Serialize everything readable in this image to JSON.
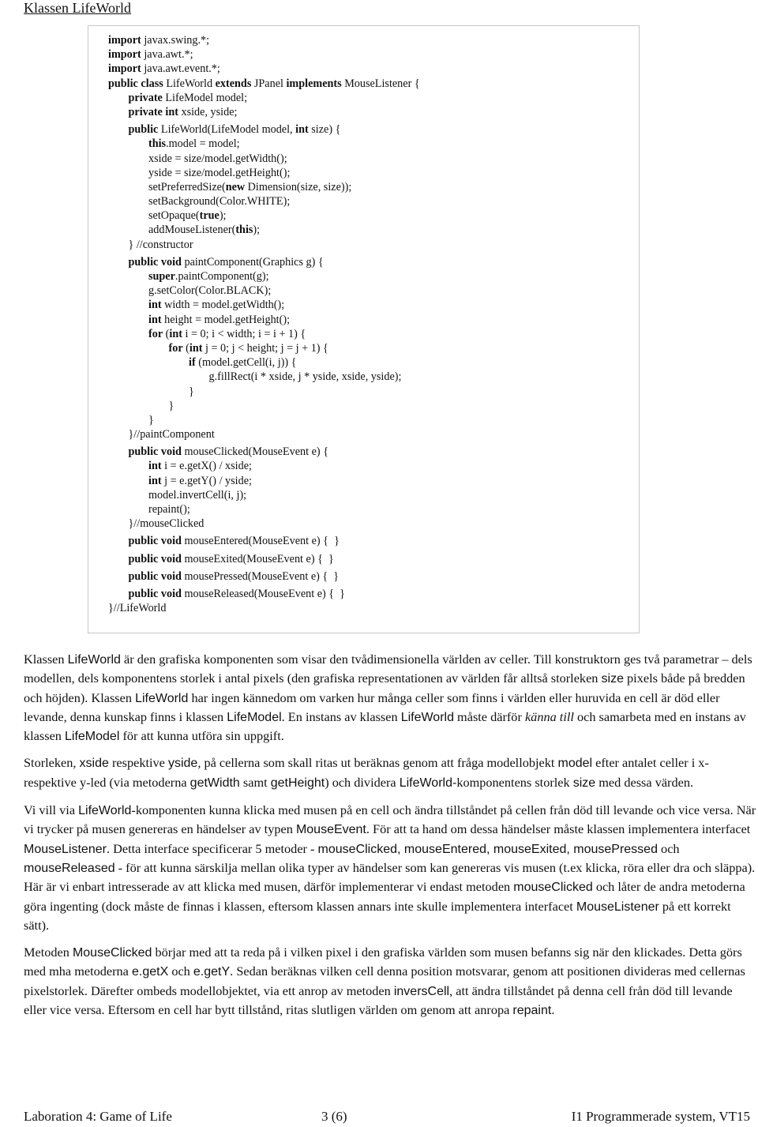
{
  "title": "Klassen LifeWorld",
  "code": [
    {
      "lines": [
        {
          "i": 0,
          "s": [
            [
              "import",
              1
            ],
            [
              " javax.swing.*;",
              0
            ]
          ]
        },
        {
          "i": 0,
          "s": [
            [
              "import",
              1
            ],
            [
              " java.awt.*;",
              0
            ]
          ]
        },
        {
          "i": 0,
          "s": [
            [
              "import",
              1
            ],
            [
              " java.awt.event.*;",
              0
            ]
          ]
        },
        {
          "i": 0,
          "s": [
            [
              "public class",
              1
            ],
            [
              " LifeWorld ",
              0
            ],
            [
              "extends",
              1
            ],
            [
              " JPanel ",
              0
            ],
            [
              "implements",
              1
            ],
            [
              " MouseListener {",
              0
            ]
          ]
        },
        {
          "i": 1,
          "s": [
            [
              "private",
              1
            ],
            [
              " LifeModel model;",
              0
            ]
          ]
        },
        {
          "i": 1,
          "s": [
            [
              "private int",
              1
            ],
            [
              " xside, yside;",
              0
            ]
          ]
        }
      ]
    },
    {
      "lines": [
        {
          "i": 1,
          "s": [
            [
              "public",
              1
            ],
            [
              " LifeWorld(LifeModel model, ",
              0
            ],
            [
              "int",
              1
            ],
            [
              " size) {",
              0
            ]
          ]
        },
        {
          "i": 2,
          "s": [
            [
              "this",
              1
            ],
            [
              ".model = model;",
              0
            ]
          ]
        },
        {
          "i": 2,
          "s": [
            [
              "xside = size/model.getWidth();",
              0
            ]
          ]
        },
        {
          "i": 2,
          "s": [
            [
              "yside = size/model.getHeight();",
              0
            ]
          ]
        },
        {
          "i": 2,
          "s": [
            [
              "setPreferredSize(",
              0
            ],
            [
              "new",
              1
            ],
            [
              " Dimension(size, size));",
              0
            ]
          ]
        },
        {
          "i": 2,
          "s": [
            [
              "setBackground(Color.WHITE);",
              0
            ]
          ]
        },
        {
          "i": 2,
          "s": [
            [
              "setOpaque(",
              0
            ],
            [
              "true",
              1
            ],
            [
              ");",
              0
            ]
          ]
        },
        {
          "i": 2,
          "s": [
            [
              "addMouseListener(",
              0
            ],
            [
              "this",
              1
            ],
            [
              ");",
              0
            ]
          ]
        },
        {
          "i": 1,
          "s": [
            [
              "} //constructor",
              0
            ]
          ]
        }
      ]
    },
    {
      "lines": [
        {
          "i": 1,
          "s": [
            [
              "public void",
              1
            ],
            [
              " paintComponent(Graphics g) {",
              0
            ]
          ]
        },
        {
          "i": 2,
          "s": [
            [
              "super",
              1
            ],
            [
              ".paintComponent(g);",
              0
            ]
          ]
        },
        {
          "i": 2,
          "s": [
            [
              "g.setColor(Color.BLACK);",
              0
            ]
          ]
        },
        {
          "i": 2,
          "s": [
            [
              "int",
              1
            ],
            [
              " width = model.getWidth();",
              0
            ]
          ]
        },
        {
          "i": 2,
          "s": [
            [
              "int",
              1
            ],
            [
              " height = model.getHeight();",
              0
            ]
          ]
        },
        {
          "i": 2,
          "s": [
            [
              "for",
              1
            ],
            [
              " (",
              0
            ],
            [
              "int",
              1
            ],
            [
              " i = 0; i < width; i = i + 1) {",
              0
            ]
          ]
        },
        {
          "i": 3,
          "s": [
            [
              "for",
              1
            ],
            [
              " (",
              0
            ],
            [
              "int",
              1
            ],
            [
              " j = 0; j < height; j = j + 1) {",
              0
            ]
          ]
        },
        {
          "i": 4,
          "s": [
            [
              "if",
              1
            ],
            [
              " (model.getCell(i, j)) {",
              0
            ]
          ]
        },
        {
          "i": 5,
          "s": [
            [
              "g.fillRect(i * xside, j * yside, xside, yside);",
              0
            ]
          ]
        },
        {
          "i": 4,
          "s": [
            [
              "}",
              0
            ]
          ]
        },
        {
          "i": 3,
          "s": [
            [
              "}",
              0
            ]
          ]
        },
        {
          "i": 2,
          "s": [
            [
              "}",
              0
            ]
          ]
        },
        {
          "i": 1,
          "s": [
            [
              "}//paintComponent",
              0
            ]
          ]
        }
      ]
    },
    {
      "lines": [
        {
          "i": 1,
          "s": [
            [
              "public void",
              1
            ],
            [
              " mouseClicked(MouseEvent e) {",
              0
            ]
          ]
        },
        {
          "i": 2,
          "s": [
            [
              "int",
              1
            ],
            [
              " i = e.getX() / xside;",
              0
            ]
          ]
        },
        {
          "i": 2,
          "s": [
            [
              "int",
              1
            ],
            [
              " j = e.getY() / yside;",
              0
            ]
          ]
        },
        {
          "i": 2,
          "s": [
            [
              "model.invertCell(i, j);",
              0
            ]
          ]
        },
        {
          "i": 2,
          "s": [
            [
              "repaint();",
              0
            ]
          ]
        },
        {
          "i": 1,
          "s": [
            [
              "}//mouseClicked",
              0
            ]
          ]
        }
      ]
    },
    {
      "lines": [
        {
          "i": 1,
          "s": [
            [
              "public void",
              1
            ],
            [
              " mouseEntered(MouseEvent e) {  }",
              0
            ]
          ]
        }
      ]
    },
    {
      "lines": [
        {
          "i": 1,
          "s": [
            [
              "public void",
              1
            ],
            [
              " mouseExited(MouseEvent e) {  }",
              0
            ]
          ]
        }
      ]
    },
    {
      "lines": [
        {
          "i": 1,
          "s": [
            [
              "public void",
              1
            ],
            [
              " mousePressed(MouseEvent e) {  }",
              0
            ]
          ]
        }
      ]
    },
    {
      "lines": [
        {
          "i": 1,
          "s": [
            [
              "public void",
              1
            ],
            [
              " mouseReleased(MouseEvent e) {  }",
              0
            ]
          ]
        },
        {
          "i": 0,
          "s": [
            [
              "}//LifeWorld",
              0
            ]
          ]
        }
      ]
    }
  ],
  "paragraphs": [
    [
      [
        "Klassen ",
        ""
      ],
      [
        "LifeWorld",
        "c"
      ],
      [
        " är den grafiska komponenten som visar den tvådimensionella världen av celler. Till konstruktorn ges två parametrar – dels modellen, dels komponentens storlek i antal pixels (den grafiska representationen av världen får alltså storleken ",
        ""
      ],
      [
        "size",
        "c"
      ],
      [
        " pixels både på bredden och höjden). Klassen ",
        ""
      ],
      [
        "LifeWorld",
        "c"
      ],
      [
        " har ingen kännedom om varken hur många celler som finns i världen eller huruvida en cell är död eller levande, denna kunskap finns i klassen ",
        ""
      ],
      [
        "LifeModel",
        "c"
      ],
      [
        ". En instans av klassen ",
        ""
      ],
      [
        "LifeWorld",
        "c"
      ],
      [
        "  måste därför ",
        ""
      ],
      [
        "känna till",
        "e"
      ],
      [
        " och samarbeta med en instans av klassen ",
        ""
      ],
      [
        "LifeModel",
        "c"
      ],
      [
        " för att kunna utföra sin uppgift.",
        ""
      ]
    ],
    [
      [
        "Storleken, ",
        ""
      ],
      [
        "xside",
        "c"
      ],
      [
        " respektive ",
        ""
      ],
      [
        "yside",
        "c"
      ],
      [
        ", på cellerna som skall ritas ut beräknas genom att fråga modellobjekt ",
        ""
      ],
      [
        "model",
        "c"
      ],
      [
        " efter antalet celler i x- respektive y-led (via metoderna ",
        ""
      ],
      [
        "getWidth",
        "c"
      ],
      [
        " samt ",
        ""
      ],
      [
        "getHeight",
        "c"
      ],
      [
        ") och dividera ",
        ""
      ],
      [
        "LifeWorld-",
        "c"
      ],
      [
        "komponentens storlek ",
        ""
      ],
      [
        "size",
        "c"
      ],
      [
        " med dessa värden.",
        ""
      ]
    ],
    [
      [
        "Vi vill via ",
        ""
      ],
      [
        "LifeWorld",
        "c"
      ],
      [
        "-komponenten kunna klicka med musen på en cell och ändra tillståndet på cellen från död till levande och vice versa. När vi trycker på musen genereras en händelser av typen ",
        ""
      ],
      [
        "MouseEvent",
        "c"
      ],
      [
        ". För att ta hand om dessa händelser måste klassen implementera interfacet ",
        ""
      ],
      [
        "MouseListener",
        "c"
      ],
      [
        ". Detta interface specificerar 5 metoder - ",
        ""
      ],
      [
        "mouseClicked, mouseEntered, mouseExited, mousePressed",
        "c"
      ],
      [
        " och ",
        ""
      ],
      [
        "mouseReleased",
        "c"
      ],
      [
        " - för att kunna särskilja mellan olika typer av händelser som kan genereras vis musen (t.ex klicka, röra eller dra och släppa). Här är vi enbart intresserade av att klicka med musen, därför implementerar vi endast metoden ",
        ""
      ],
      [
        "mouseClicked",
        "c"
      ],
      [
        " och låter de andra metoderna göra ingenting (dock måste de finnas i klassen, eftersom klassen annars inte skulle implementera interfacet ",
        ""
      ],
      [
        "MouseListener",
        "c"
      ],
      [
        " på ett korrekt sätt).",
        ""
      ]
    ],
    [
      [
        "Metoden ",
        ""
      ],
      [
        "MouseClicked",
        "c"
      ],
      [
        " börjar med att ta reda på i vilken pixel i den grafiska världen som musen befanns sig när den klickades. Detta görs med  mha metoderna ",
        ""
      ],
      [
        "e.getX",
        "c"
      ],
      [
        " och ",
        ""
      ],
      [
        "e.getY",
        "c"
      ],
      [
        ". Sedan beräknas vilken cell denna position motsvarar, genom att positionen divideras med cellernas pixelstorlek. Därefter ombeds modellobjektet, via ett anrop av metoden ",
        ""
      ],
      [
        "inversCell",
        "c"
      ],
      [
        ", att ändra tillståndet på denna cell från död till levande eller vice versa. Eftersom en cell har bytt tillstånd, ritas slutligen världen om genom att anropa ",
        ""
      ],
      [
        "repaint",
        "c"
      ],
      [
        ".",
        ""
      ]
    ]
  ],
  "footer": {
    "left": "Laboration 4: Game of Life",
    "center": "3 (6)",
    "right": "I1 Programmerade system, VT15"
  }
}
